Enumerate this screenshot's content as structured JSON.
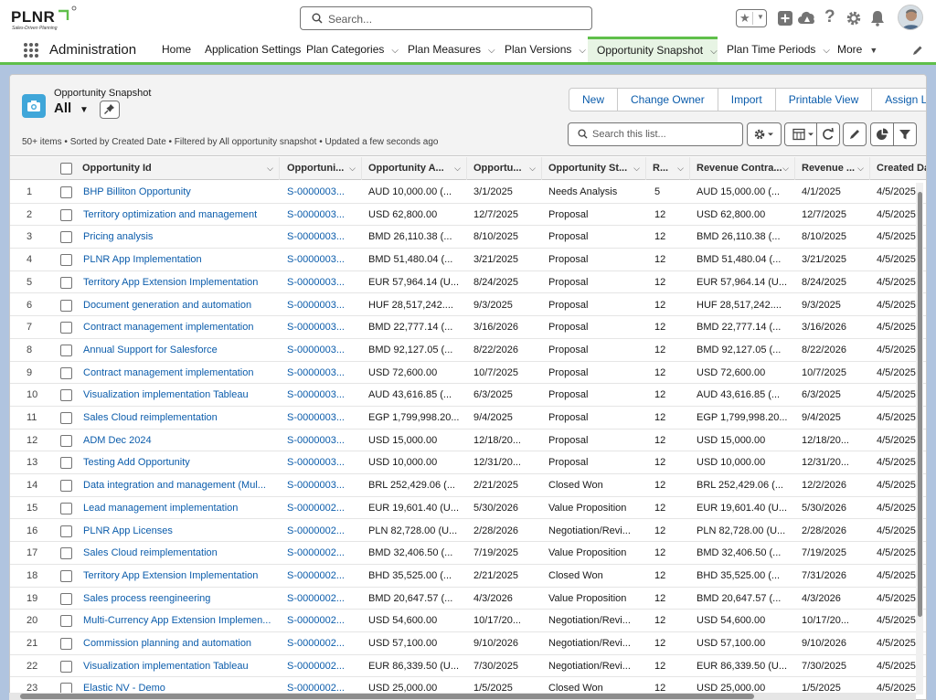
{
  "brand": {
    "logo_text": "PLNR",
    "tagline": "Sales-Driven Planning"
  },
  "header": {
    "search_placeholder": "Search..."
  },
  "nav": {
    "app_name": "Administration",
    "items": [
      {
        "label": "Home",
        "has_menu": false
      },
      {
        "label": "Application Settings",
        "has_menu": false
      },
      {
        "label": "Plan Categories",
        "has_menu": true
      },
      {
        "label": "Plan Measures",
        "has_menu": true
      },
      {
        "label": "Plan Versions",
        "has_menu": true
      },
      {
        "label": "Opportunity Snapshot",
        "has_menu": true,
        "active": true
      },
      {
        "label": "Plan Time Periods",
        "has_menu": true
      },
      {
        "label": "More",
        "has_menu": true
      }
    ]
  },
  "list_view": {
    "object_label": "Opportunity Snapshot",
    "view_name": "All",
    "actions": [
      "New",
      "Change Owner",
      "Import",
      "Printable View",
      "Assign Label"
    ],
    "meta": "50+ items • Sorted by Created Date • Filtered by All opportunity snapshot • Updated a few seconds ago",
    "search_placeholder": "Search this list..."
  },
  "table": {
    "columns": [
      "Opportunity Id",
      "Opportuni...",
      "Opportunity A...",
      "Opportu...",
      "Opportunity St...",
      "R...",
      "Revenue Contra...",
      "Revenue ...",
      "Created Da"
    ],
    "rows": [
      [
        "1",
        "BHP Billiton Opportunity",
        "S-0000003...",
        "AUD 10,000.00 (...",
        "3/1/2025",
        "Needs Analysis",
        "5",
        "AUD 15,000.00 (...",
        "4/1/2025",
        "4/5/2025"
      ],
      [
        "2",
        "Territory optimization and management",
        "S-0000003...",
        "USD 62,800.00",
        "12/7/2025",
        "Proposal",
        "12",
        "USD 62,800.00",
        "12/7/2025",
        "4/5/2025"
      ],
      [
        "3",
        "Pricing analysis",
        "S-0000003...",
        "BMD 26,110.38 (...",
        "8/10/2025",
        "Proposal",
        "12",
        "BMD 26,110.38 (...",
        "8/10/2025",
        "4/5/2025"
      ],
      [
        "4",
        "PLNR App Implementation",
        "S-0000003...",
        "BMD 51,480.04 (...",
        "3/21/2025",
        "Proposal",
        "12",
        "BMD 51,480.04 (...",
        "3/21/2025",
        "4/5/2025"
      ],
      [
        "5",
        "Territory App Extension Implementation",
        "S-0000003...",
        "EUR 57,964.14 (U...",
        "8/24/2025",
        "Proposal",
        "12",
        "EUR 57,964.14 (U...",
        "8/24/2025",
        "4/5/2025"
      ],
      [
        "6",
        "Document generation and automation",
        "S-0000003...",
        "HUF 28,517,242....",
        "9/3/2025",
        "Proposal",
        "12",
        "HUF 28,517,242....",
        "9/3/2025",
        "4/5/2025"
      ],
      [
        "7",
        "Contract management implementation",
        "S-0000003...",
        "BMD 22,777.14 (...",
        "3/16/2026",
        "Proposal",
        "12",
        "BMD 22,777.14 (...",
        "3/16/2026",
        "4/5/2025"
      ],
      [
        "8",
        "Annual Support for Salesforce",
        "S-0000003...",
        "BMD 92,127.05 (...",
        "8/22/2026",
        "Proposal",
        "12",
        "BMD 92,127.05 (...",
        "8/22/2026",
        "4/5/2025"
      ],
      [
        "9",
        "Contract management implementation",
        "S-0000003...",
        "USD 72,600.00",
        "10/7/2025",
        "Proposal",
        "12",
        "USD 72,600.00",
        "10/7/2025",
        "4/5/2025"
      ],
      [
        "10",
        "Visualization implementation Tableau",
        "S-0000003...",
        "AUD 43,616.85 (...",
        "6/3/2025",
        "Proposal",
        "12",
        "AUD 43,616.85 (...",
        "6/3/2025",
        "4/5/2025"
      ],
      [
        "11",
        "Sales Cloud reimplementation",
        "S-0000003...",
        "EGP 1,799,998.20...",
        "9/4/2025",
        "Proposal",
        "12",
        "EGP 1,799,998.20...",
        "9/4/2025",
        "4/5/2025"
      ],
      [
        "12",
        "ADM Dec 2024",
        "S-0000003...",
        "USD 15,000.00",
        "12/18/20...",
        "Proposal",
        "12",
        "USD 15,000.00",
        "12/18/20...",
        "4/5/2025"
      ],
      [
        "13",
        "Testing Add Opportunity",
        "S-0000003...",
        "USD 10,000.00",
        "12/31/20...",
        "Proposal",
        "12",
        "USD 10,000.00",
        "12/31/20...",
        "4/5/2025"
      ],
      [
        "14",
        "Data integration and management (Mul...",
        "S-0000003...",
        "BRL 252,429.06 (...",
        "2/21/2025",
        "Closed Won",
        "12",
        "BRL 252,429.06 (...",
        "12/2/2026",
        "4/5/2025"
      ],
      [
        "15",
        "Lead management implementation",
        "S-0000002...",
        "EUR 19,601.40 (U...",
        "5/30/2026",
        "Value Proposition",
        "12",
        "EUR 19,601.40 (U...",
        "5/30/2026",
        "4/5/2025"
      ],
      [
        "16",
        "PLNR App Licenses",
        "S-0000002...",
        "PLN 82,728.00 (U...",
        "2/28/2026",
        "Negotiation/Revi...",
        "12",
        "PLN 82,728.00 (U...",
        "2/28/2026",
        "4/5/2025"
      ],
      [
        "17",
        "Sales Cloud reimplementation",
        "S-0000002...",
        "BMD 32,406.50 (...",
        "7/19/2025",
        "Value Proposition",
        "12",
        "BMD 32,406.50 (...",
        "7/19/2025",
        "4/5/2025"
      ],
      [
        "18",
        "Territory App Extension Implementation",
        "S-0000002...",
        "BHD 35,525.00 (...",
        "2/21/2025",
        "Closed Won",
        "12",
        "BHD 35,525.00 (...",
        "7/31/2026",
        "4/5/2025"
      ],
      [
        "19",
        "Sales process reengineering",
        "S-0000002...",
        "BMD 20,647.57 (...",
        "4/3/2026",
        "Value Proposition",
        "12",
        "BMD 20,647.57 (...",
        "4/3/2026",
        "4/5/2025"
      ],
      [
        "20",
        "Multi-Currency App Extension Implemen...",
        "S-0000002...",
        "USD 54,600.00",
        "10/17/20...",
        "Negotiation/Revi...",
        "12",
        "USD 54,600.00",
        "10/17/20...",
        "4/5/2025"
      ],
      [
        "21",
        "Commission planning and automation",
        "S-0000002...",
        "USD 57,100.00",
        "9/10/2026",
        "Negotiation/Revi...",
        "12",
        "USD 57,100.00",
        "9/10/2026",
        "4/5/2025"
      ],
      [
        "22",
        "Visualization implementation Tableau",
        "S-0000002...",
        "EUR 86,339.50 (U...",
        "7/30/2025",
        "Negotiation/Revi...",
        "12",
        "EUR 86,339.50 (U...",
        "7/30/2025",
        "4/5/2025"
      ],
      [
        "23",
        "Elastic NV - Demo",
        "S-0000002...",
        "USD 25,000.00",
        "1/5/2025",
        "Closed Won",
        "12",
        "USD 25,000.00",
        "1/5/2025",
        "4/5/2025"
      ]
    ]
  },
  "colors": {
    "accent": "#5fbf4a",
    "link": "#0b5cab",
    "object_icon": "#3fa6d9"
  }
}
